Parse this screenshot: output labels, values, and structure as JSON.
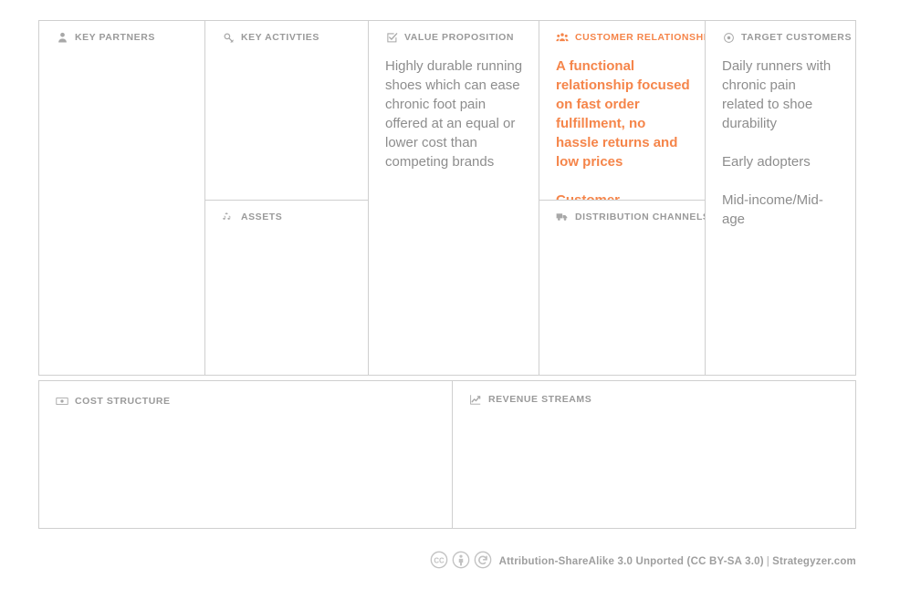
{
  "canvas": {
    "accent_color": "#f5854a",
    "text_color": "#8d8d8d",
    "header_color": "#9a9a9a",
    "border_color": "#cfcfcf",
    "blocks": {
      "key_partners": {
        "title": "KEY PARTNERS",
        "icon": "user-icon",
        "body": []
      },
      "key_activities": {
        "title": "KEY ACTIVTIES",
        "icon": "wrench-icon",
        "body": []
      },
      "assets": {
        "title": "ASSETS",
        "icon": "cubes-icon",
        "body": []
      },
      "value_proposition": {
        "title": "VALUE PROPOSITION",
        "icon": "checked-box-icon",
        "body": [
          "Highly durable running shoes which can ease chronic foot pain offered at an equal or lower cost than competing brands"
        ]
      },
      "customer_relationships": {
        "title": "CUSTOMER RELATIONSHIPS",
        "icon": "users-group-icon",
        "highlighted": true,
        "body": [
          "A functional relationship focused on fast order fulfillment, no hassle returns and low prices",
          "Customer promoters"
        ]
      },
      "distribution_channels": {
        "title": "DISTRIBUTION CHANNELS",
        "icon": "truck-icon",
        "body": []
      },
      "target_customers": {
        "title": "TARGET CUSTOMERS",
        "icon": "crosshair-icon",
        "body": [
          "Daily runners with chronic pain related to shoe durability",
          "Early adopters",
          "Mid-income/Mid-age"
        ]
      },
      "cost_structure": {
        "title": "COST STRUCTURE",
        "icon": "money-bill-icon",
        "body": []
      },
      "revenue_streams": {
        "title": "REVENUE STREAMS",
        "icon": "line-chart-icon",
        "body": []
      }
    }
  },
  "footer": {
    "license": "Attribution-ShareAlike 3.0 Unported (CC BY-SA 3.0)",
    "separator": "|",
    "source": "Strategyzer.com",
    "badges": [
      "cc-logo-icon",
      "attribution-person-icon",
      "share-alike-icon"
    ]
  }
}
